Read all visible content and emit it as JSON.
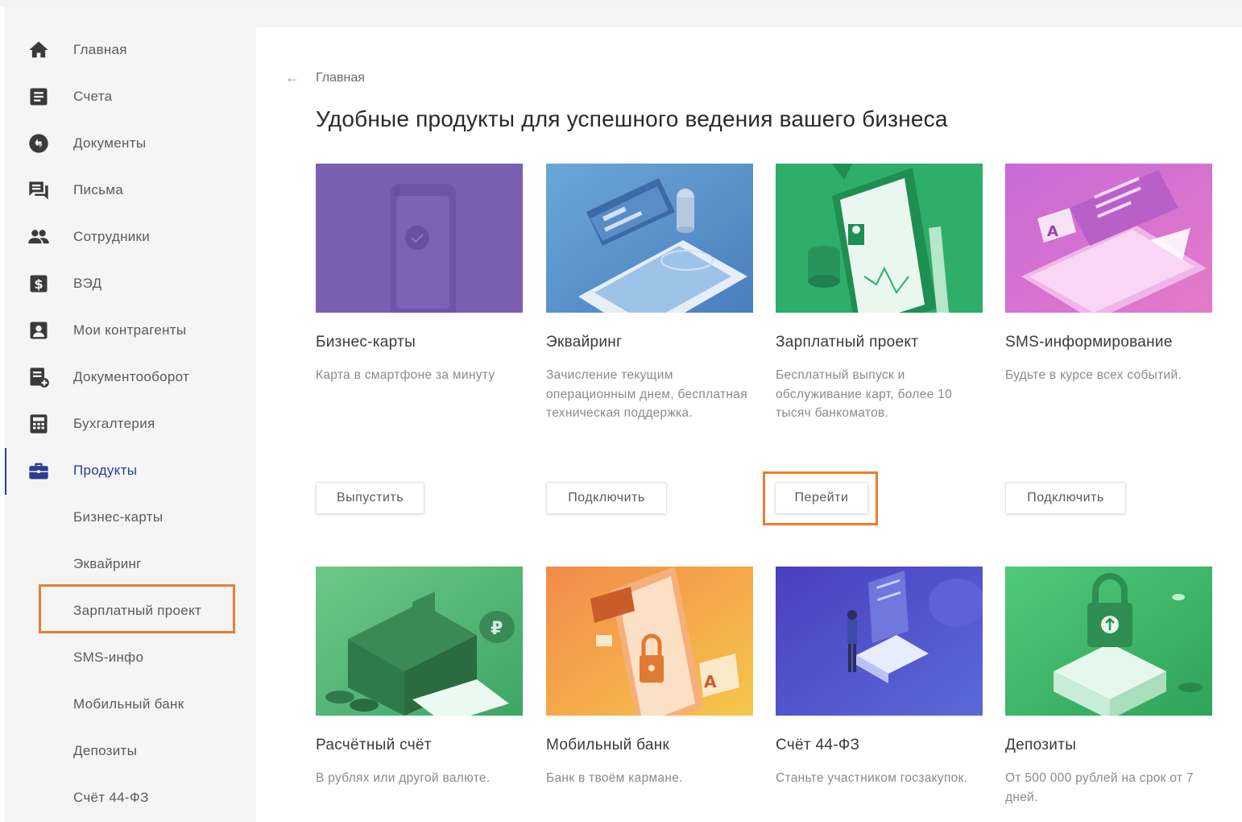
{
  "sidebar": {
    "items": [
      {
        "label": "Главная",
        "icon": "home-icon"
      },
      {
        "label": "Счета",
        "icon": "accounts-icon"
      },
      {
        "label": "Документы",
        "icon": "documents-icon"
      },
      {
        "label": "Письма",
        "icon": "letters-icon"
      },
      {
        "label": "Сотрудники",
        "icon": "employees-icon"
      },
      {
        "label": "ВЭД",
        "icon": "dollar-icon"
      },
      {
        "label": "Мои контрагенты",
        "icon": "contact-icon"
      },
      {
        "label": "Документооборот",
        "icon": "doc-flow-icon"
      },
      {
        "label": "Бухгалтерия",
        "icon": "calculator-icon"
      },
      {
        "label": "Продукты",
        "icon": "briefcase-icon"
      }
    ],
    "sub_items": [
      {
        "label": "Бизнес-карты"
      },
      {
        "label": "Эквайринг"
      },
      {
        "label": "Зарплатный проект"
      },
      {
        "label": "SMS-инфо"
      },
      {
        "label": "Мобильный банк"
      },
      {
        "label": "Депозиты"
      },
      {
        "label": "Счёт 44-ФЗ"
      }
    ],
    "active_color": "#2b3d8f"
  },
  "breadcrumb": {
    "label": "Главная"
  },
  "page_title": "Удобные продукты для успешного ведения вашего бизнеса",
  "highlight_color": "#ec7d30",
  "cards": [
    {
      "name": "Бизнес-карты",
      "desc": "Карта в смартфоне за минуту",
      "button": "Выпустить"
    },
    {
      "name": "Эквайринг",
      "desc": "Зачисление текущим операционным днем, бесплатная техническая поддержка.",
      "button": "Подключить"
    },
    {
      "name": "Зарплатный проект",
      "desc": "Бесплатный выпуск и обслуживание карт, более 10 тысяч банкоматов.",
      "button": "Перейти"
    },
    {
      "name": "SMS-информирование",
      "desc": "Будьте в курсе всех событий.",
      "button": "Подключить"
    },
    {
      "name": "Расчётный счёт",
      "desc": "В рублях или другой валюте."
    },
    {
      "name": "Мобильный банк",
      "desc": "Банк в твоём кармане."
    },
    {
      "name": "Счёт 44-ФЗ",
      "desc": "Станьте участником госзакупок."
    },
    {
      "name": "Депозиты",
      "desc": "От 500 000 рублей на срок от 7 дней."
    }
  ]
}
